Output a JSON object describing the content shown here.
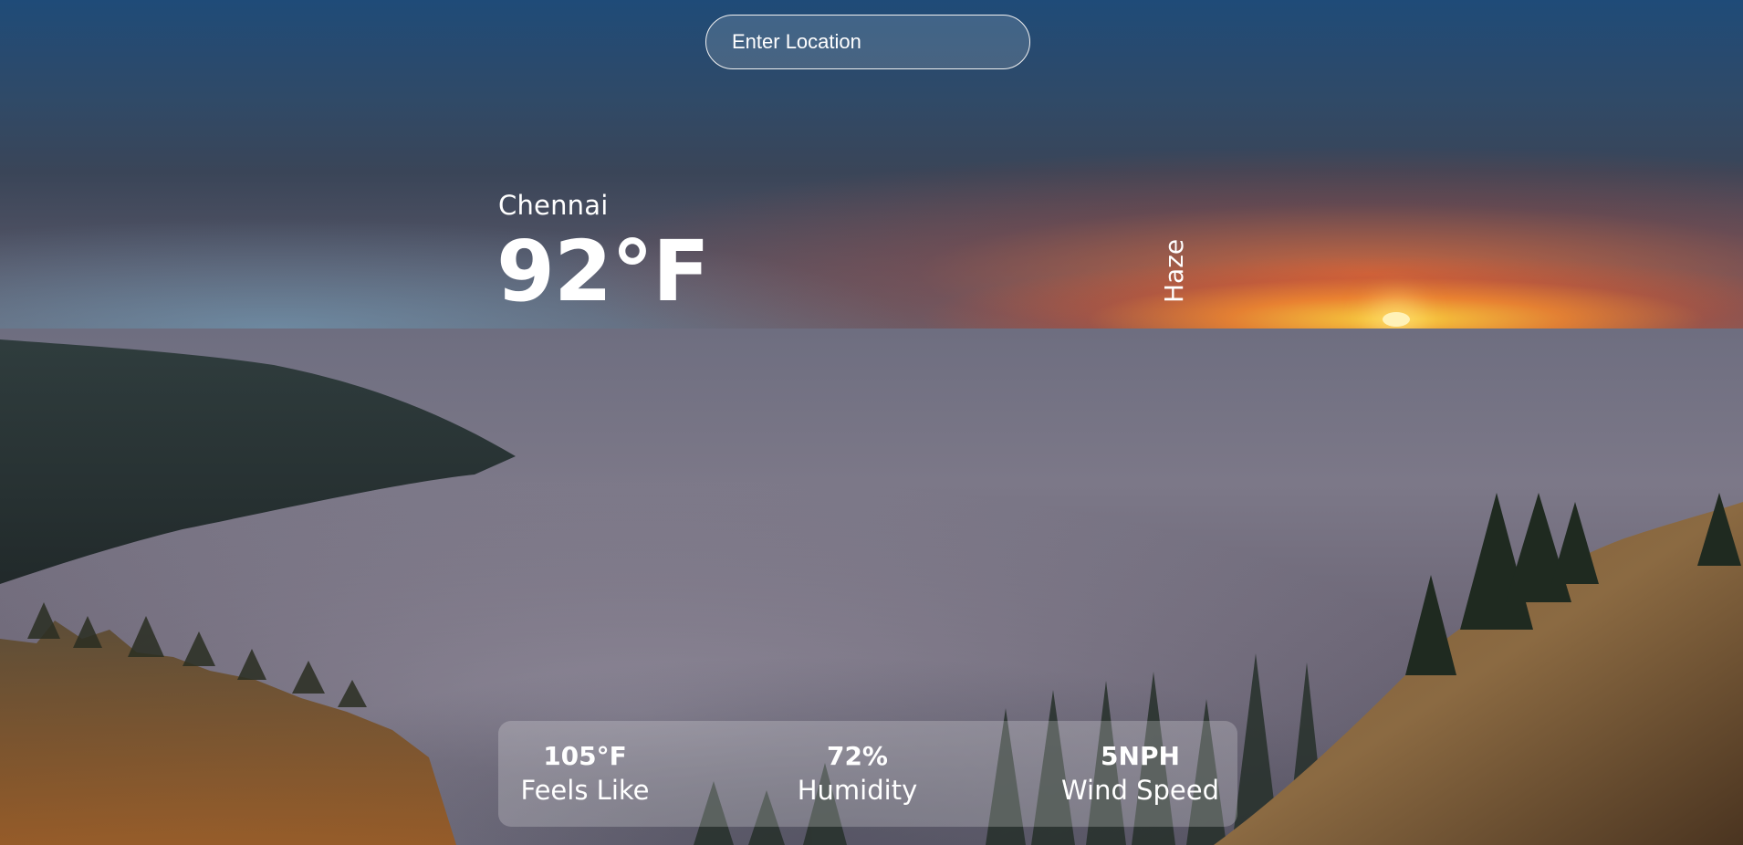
{
  "search": {
    "placeholder": "Enter Location",
    "value": ""
  },
  "weather": {
    "location": "Chennai",
    "temperature": "92°F",
    "condition": "Haze"
  },
  "stats": [
    {
      "value": "105°F",
      "label": "Feels Like"
    },
    {
      "value": "72%",
      "label": "Humidity"
    },
    {
      "value": "5NPH",
      "label": "Wind Speed"
    }
  ]
}
